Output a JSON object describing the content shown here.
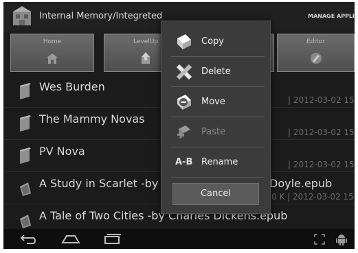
{
  "header": {
    "path_title": "Internal Memory/Integreted",
    "manage_label": "MANAGE APPLI"
  },
  "toolbar": {
    "buttons": [
      {
        "label": "Home",
        "icon": "home-icon"
      },
      {
        "label": "LevelUp",
        "icon": "level-up-icon"
      },
      {
        "label": "",
        "icon": ""
      },
      {
        "label": "",
        "icon": ""
      },
      {
        "label": "Editor",
        "icon": "editor-icon"
      }
    ]
  },
  "files": [
    {
      "name": "Wes Burden",
      "meta": "| 2012-03-02 15",
      "icon": "folder-icon"
    },
    {
      "name": "The Mammy Novas",
      "meta": "| 2012-03-02 15",
      "icon": "folder-icon"
    },
    {
      "name": "PV Nova",
      "meta": "| 2012-03-02 15",
      "icon": "folder-icon"
    },
    {
      "name": "A Study in Scarlet -by",
      "name_tail": "Doyle.epub",
      "meta": "0 K | 2012-03-02 15",
      "icon": "book-icon"
    },
    {
      "name": "A Tale of Two Cities -by Charles Dickens.epub",
      "meta": "",
      "icon": "book-icon"
    }
  ],
  "context_menu": {
    "items": [
      {
        "label": "Copy",
        "icon": "copy-icon",
        "enabled": true
      },
      {
        "label": "Delete",
        "icon": "delete-icon",
        "enabled": true
      },
      {
        "label": "Move",
        "icon": "move-icon",
        "enabled": true
      },
      {
        "label": "Paste",
        "icon": "paste-icon",
        "enabled": false
      },
      {
        "label": "Rename",
        "icon": "rename-icon",
        "enabled": true
      }
    ],
    "cancel_label": "Cancel",
    "rename_glyph": "A-B"
  },
  "navbar": {
    "icons": [
      "back-icon",
      "home-nav-icon",
      "recent-apps-icon",
      "screen-fit-icon",
      "android-icon"
    ]
  }
}
